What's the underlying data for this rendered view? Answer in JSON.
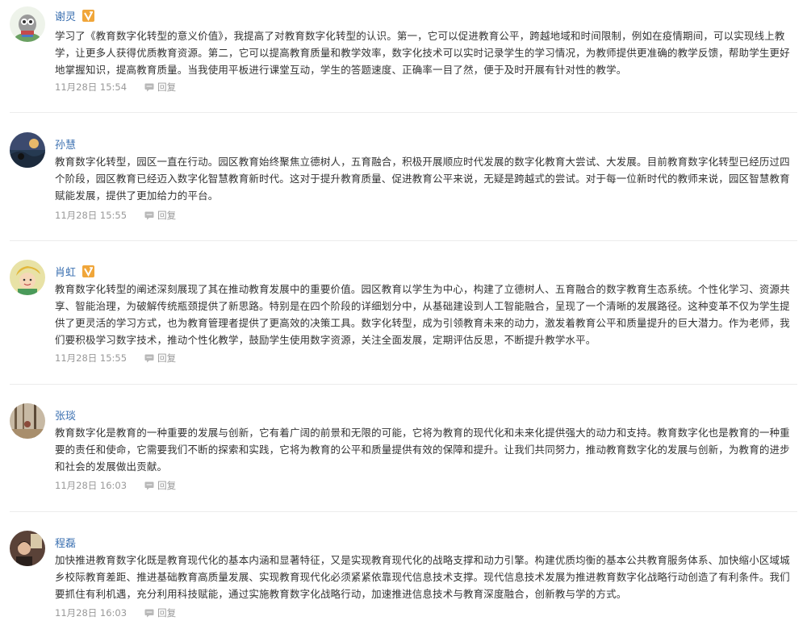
{
  "colors": {
    "author_name": "#3a6fb0",
    "badge": "#f0a63a",
    "meta": "#999999",
    "divider": "#ececec"
  },
  "comments": [
    {
      "author": "谢灵",
      "badge_icon": "verified-v-icon",
      "text": "学习了《教育数字化转型的意义价值》，我提高了对教育数字化转型的认识。第一，它可以促进教育公平，跨越地域和时间限制，例如在疫情期间，可以实现线上教学，让更多人获得优质教育资源。第二，它可以提高教育质量和教学效率，数字化技术可以实时记录学生的学习情况，为教师提供更准确的教学反馈，帮助学生更好地掌握知识，提高教育质量。当我使用平板进行课堂互动，学生的答题速度、正确率一目了然，便于及时开展有针对性的教学。",
      "time": "11月28日 15:54",
      "reply_label": "回复"
    },
    {
      "author": "孙慧",
      "badge_icon": "",
      "text": "教育数字化转型，园区一直在行动。园区教育始终聚焦立德树人，五育融合，积极开展顺应时代发展的数字化教育大尝试、大发展。目前教育数字化转型已经历过四个阶段，园区教育已经迈入数字化智慧教育新时代。这对于提升教育质量、促进教育公平来说，无疑是跨越式的尝试。对于每一位新时代的教师来说，园区智慧教育赋能发展，提供了更加给力的平台。",
      "time": "11月28日 15:55",
      "reply_label": "回复"
    },
    {
      "author": "肖虹",
      "badge_icon": "verified-v-icon",
      "text": "教育数字化转型的阐述深刻展现了其在推动教育发展中的重要价值。园区教育以学生为中心，构建了立德树人、五育融合的数字教育生态系统。个性化学习、资源共享、智能治理，为破解传统瓶颈提供了新思路。特别是在四个阶段的详细划分中，从基础建设到人工智能融合，呈现了一个清晰的发展路径。这种变革不仅为学生提供了更灵活的学习方式，也为教育管理者提供了更高效的决策工具。数字化转型，成为引领教育未来的动力，激发着教育公平和质量提升的巨大潜力。作为老师，我们要积极学习数字技术，推动个性化教学，鼓励学生使用数字资源，关注全面发展，定期评估反思，不断提升教学水平。",
      "time": "11月28日 15:55",
      "reply_label": "回复"
    },
    {
      "author": "张琰",
      "badge_icon": "verified-v-icon",
      "text": "教育数字化是教育的一种重要的发展与创新，它有着广阔的前景和无限的可能，它将为教育的现代化和未来化提供强大的动力和支持。教育数字化也是教育的一种重要的责任和使命，它需要我们不断的探索和实践，它将为教育的公平和质量提供有效的保障和提升。让我们共同努力，推动教育数字化的发展与创新，为教育的进步和社会的发展做出贡献。",
      "time": "11月28日 16:03",
      "reply_label": "回复"
    },
    {
      "author": "程磊",
      "badge_icon": "",
      "text": "加快推进教育数字化既是教育现代化的基本内涵和显著特征，又是实现教育现代化的战略支撑和动力引擎。构建优质均衡的基本公共教育服务体系、加快缩小区域城乡校际教育差距、推进基础教育高质量发展、实现教育现代化必须紧紧依靠现代信息技术支撑。现代信息技术发展为推进教育数字化战略行动创造了有利条件。我们要抓住有利机遇，充分利用科技赋能，通过实施教育数字化战略行动，加速推进信息技术与教育深度融合，创新教与学的方式。",
      "time": "11月28日 16:03",
      "reply_label": "回复"
    }
  ]
}
